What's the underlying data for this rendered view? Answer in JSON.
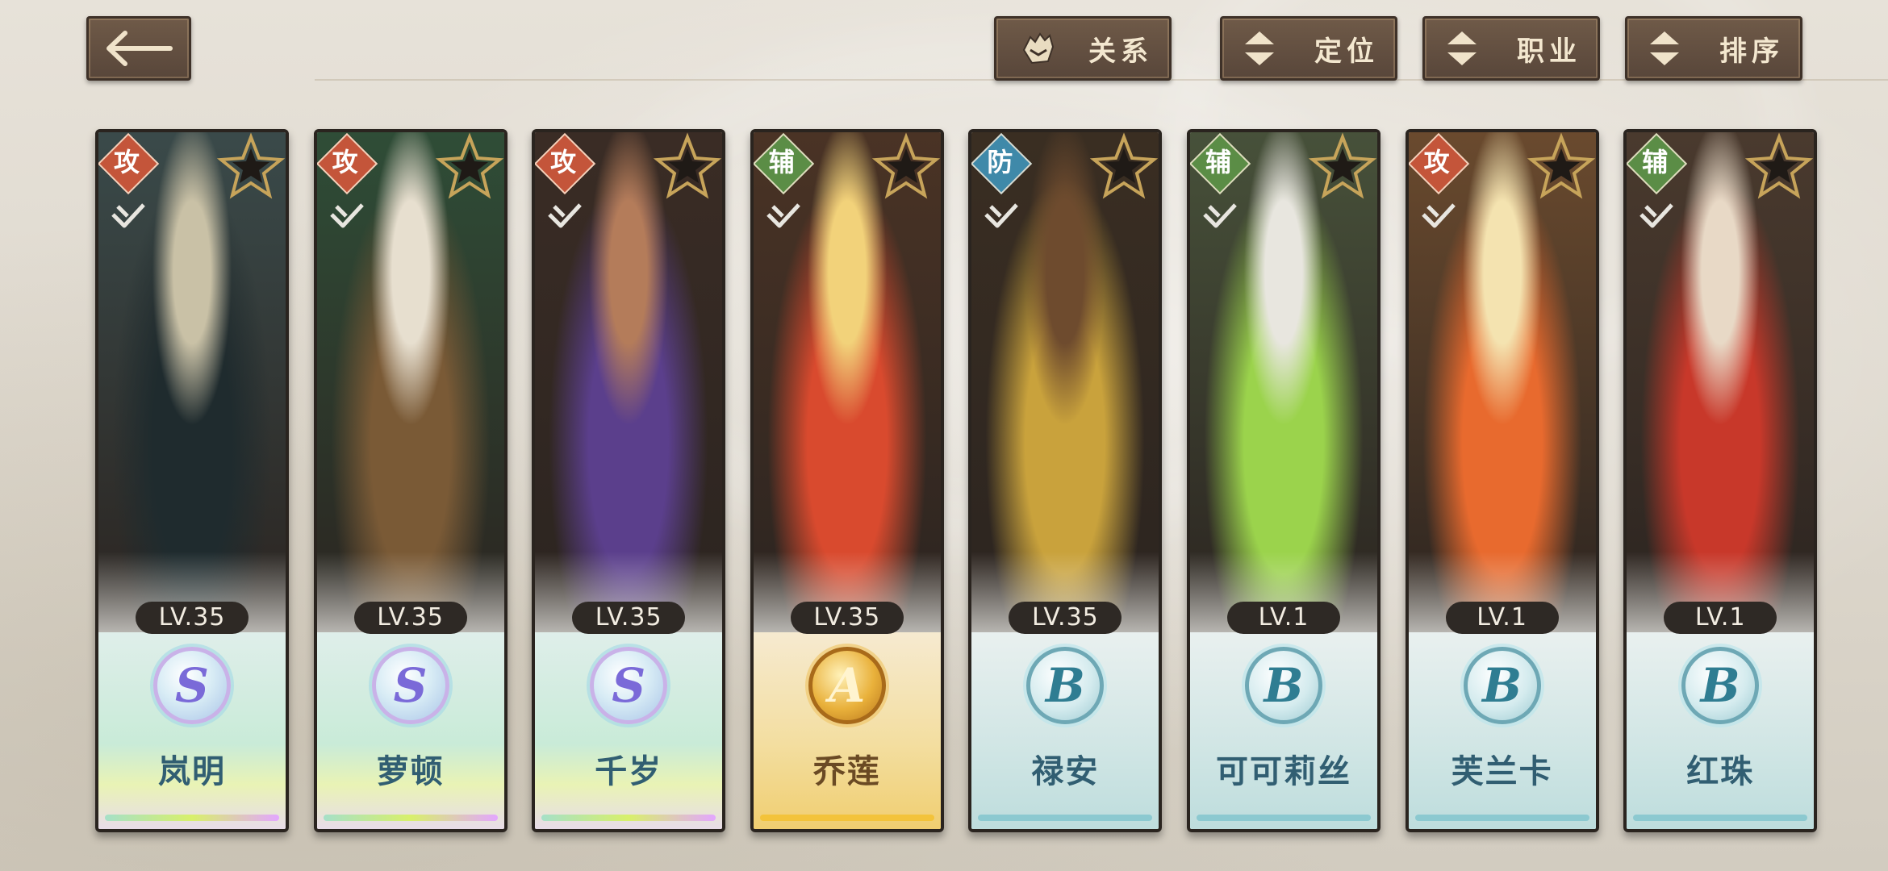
{
  "toolbar": {
    "filters": [
      {
        "label": "关系",
        "icon": "relation-icon"
      },
      {
        "label": "定位",
        "icon": "updown-icon"
      },
      {
        "label": "职业",
        "icon": "updown-icon"
      },
      {
        "label": "排序",
        "icon": "updown-icon"
      }
    ]
  },
  "characters": [
    {
      "name": "岚明",
      "role": "攻",
      "level": "LV.35",
      "rank": "S",
      "portrait_colors": [
        "#3a4a4a",
        "#1f2b2e",
        "#c9c1a6"
      ]
    },
    {
      "name": "萝顿",
      "role": "攻",
      "level": "LV.35",
      "rank": "S",
      "portrait_colors": [
        "#2f4d37",
        "#7a5a36",
        "#e7dfcf"
      ]
    },
    {
      "name": "千岁",
      "role": "攻",
      "level": "LV.35",
      "rank": "S",
      "portrait_colors": [
        "#3a2c25",
        "#5b3f8c",
        "#b47c5a"
      ]
    },
    {
      "name": "乔莲",
      "role": "辅",
      "level": "LV.35",
      "rank": "A",
      "portrait_colors": [
        "#4a3325",
        "#d94a2e",
        "#f2d27a"
      ]
    },
    {
      "name": "禄安",
      "role": "防",
      "level": "LV.35",
      "rank": "B",
      "portrait_colors": [
        "#3a2e22",
        "#c9a23c",
        "#6e4b2e"
      ]
    },
    {
      "name": "可可莉丝",
      "role": "辅",
      "level": "LV.1",
      "rank": "B",
      "portrait_colors": [
        "#47513a",
        "#9bd34c",
        "#e8e6df"
      ]
    },
    {
      "name": "芙兰卡",
      "role": "攻",
      "level": "LV.1",
      "rank": "B",
      "portrait_colors": [
        "#6a4a2e",
        "#e86a2e",
        "#f4e3b0"
      ]
    },
    {
      "name": "红珠",
      "role": "辅",
      "level": "LV.1",
      "rank": "B",
      "portrait_colors": [
        "#4a3a2e",
        "#c8382a",
        "#e8d9c6"
      ]
    }
  ]
}
